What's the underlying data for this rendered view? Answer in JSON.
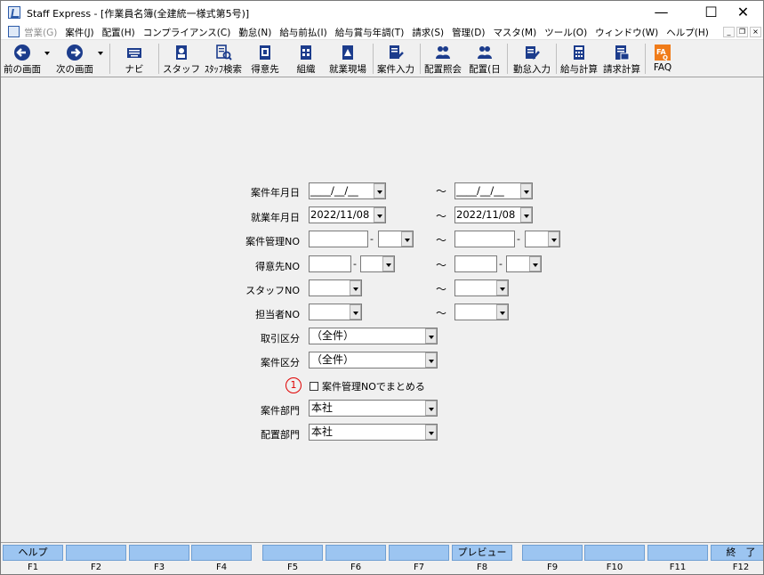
{
  "window": {
    "title": "Staff Express - [作業員名簿(全建統一様式第5号)]",
    "controls": {
      "minimize": "—",
      "maximize": "☐",
      "close": "✕"
    }
  },
  "menu": {
    "items": [
      {
        "label": "営業(G)",
        "disabled": true
      },
      {
        "label": "案件(J)"
      },
      {
        "label": "配置(H)"
      },
      {
        "label": "コンプライアンス(C)"
      },
      {
        "label": "勤怠(N)"
      },
      {
        "label": "給与前払(I)"
      },
      {
        "label": "給与賞与年調(T)"
      },
      {
        "label": "請求(S)"
      },
      {
        "label": "管理(D)"
      },
      {
        "label": "マスタ(M)"
      },
      {
        "label": "ツール(O)"
      },
      {
        "label": "ウィンドウ(W)"
      },
      {
        "label": "ヘルプ(H)"
      }
    ],
    "mdi_controls": {
      "minimize": "_",
      "restore": "❐",
      "close": "×"
    }
  },
  "toolbar": {
    "prev_screen": "前の画面",
    "next_screen": "次の画面",
    "navi": "ナビ",
    "staff": "スタッフ",
    "staff_search": "ｽﾀｯﾌ検索",
    "customer": "得意先",
    "organization": "組織",
    "work_site": "就業現場",
    "case_input": "案件入力",
    "assignment_inquiry": "配置照会",
    "assignment_day": "配置(日",
    "attendance_input": "勤怠入力",
    "payroll_calc": "給与計算",
    "billing_calc": "請求計算",
    "faq": "FAQ"
  },
  "form": {
    "case_date": {
      "label": "案件年月日",
      "from": "____/__/__",
      "to": "____/__/__"
    },
    "work_date": {
      "label": "就業年月日",
      "from": "2022/11/08",
      "to": "2022/11/08"
    },
    "case_mgmt_no": {
      "label": "案件管理NO",
      "from_main": "",
      "from_sub": "",
      "to_main": "",
      "to_sub": ""
    },
    "customer_no": {
      "label": "得意先NO",
      "from_main": "",
      "from_sub": "",
      "to_main": "",
      "to_sub": ""
    },
    "staff_no": {
      "label": "スタッフNO",
      "from": "",
      "to": ""
    },
    "person_in_charge_no": {
      "label": "担当者NO",
      "from": "",
      "to": ""
    },
    "transaction_type": {
      "label": "取引区分",
      "value": "（全件）"
    },
    "case_type": {
      "label": "案件区分",
      "value": "（全件）"
    },
    "group_by_case_no": {
      "marker": "1",
      "label": "案件管理NOでまとめる",
      "checked": false
    },
    "case_dept": {
      "label": "案件部門",
      "value": "本社"
    },
    "assign_dept": {
      "label": "配置部門",
      "value": "本社"
    },
    "tilde": "～",
    "dash": "-"
  },
  "fkeys": [
    {
      "key": "F1",
      "label": "ヘルプ"
    },
    {
      "key": "F2",
      "label": ""
    },
    {
      "key": "F3",
      "label": ""
    },
    {
      "key": "F4",
      "label": ""
    },
    {
      "key": "F5",
      "label": ""
    },
    {
      "key": "F6",
      "label": ""
    },
    {
      "key": "F7",
      "label": ""
    },
    {
      "key": "F8",
      "label": "プレビュー"
    },
    {
      "key": "F9",
      "label": ""
    },
    {
      "key": "F10",
      "label": ""
    },
    {
      "key": "F11",
      "label": ""
    },
    {
      "key": "F12",
      "label": "終　了"
    }
  ],
  "colors": {
    "fkey_bg": "#9cc5f1",
    "icon_blue": "#1c3c8c",
    "marker_red": "#e00000",
    "faq_orange": "#f07c1a"
  }
}
